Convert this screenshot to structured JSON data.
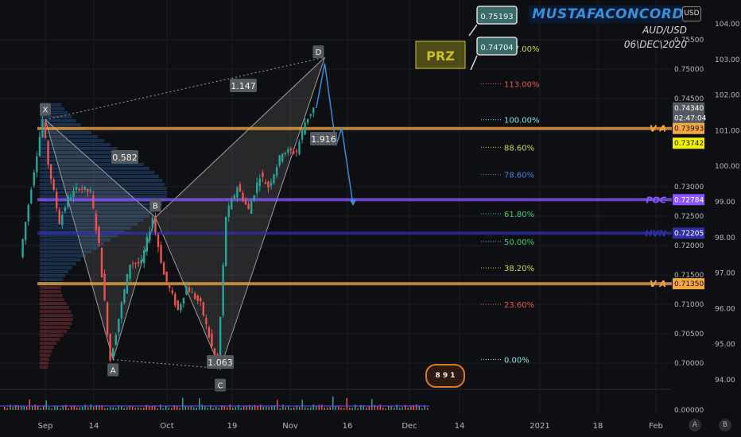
{
  "header": {
    "brand": "MUSTAFACONCORD",
    "symbol": "AUD/USD",
    "date": "06\\DEC\\2020",
    "currency_button": "USD"
  },
  "buttons": {
    "auto": "A",
    "b": "B"
  },
  "badge_text": "8 9 1",
  "colors": {
    "up": "#26a69a",
    "down": "#ef5350",
    "orange": "#f5a742",
    "purple": "#8a55ff",
    "navy": "#3030a8",
    "pattern_fill": "#9a9a9a",
    "projection": "#3d8bd8"
  },
  "chart_data": {
    "type": "candlestick",
    "symbol": "AUD/USD",
    "date_label": "06\\DEC\\2020",
    "x_ticks": [
      "Sep",
      "14",
      "Oct",
      "19",
      "Nov",
      "16",
      "Dec",
      "14",
      "2021",
      "18",
      "Feb"
    ],
    "price_axis": {
      "ticks": [
        "0.75500",
        "0.75000",
        "0.74500",
        "0.73000",
        "0.72500",
        "0.72000",
        "0.71500",
        "0.71000",
        "0.70500",
        "0.70000"
      ],
      "markers": [
        {
          "label": "0.74340",
          "price": 0.7434,
          "style": "grey"
        },
        {
          "label": "02:47:04",
          "price": 0.7417,
          "style": "grey"
        },
        {
          "label": "0.73993",
          "price": 0.7399,
          "style": "orange"
        },
        {
          "label": "0.73742",
          "price": 0.7374,
          "style": "yellow"
        },
        {
          "label": "0.72784",
          "price": 0.7278,
          "style": "purple"
        },
        {
          "label": "0.72205",
          "price": 0.7221,
          "style": "navy"
        },
        {
          "label": "0.71350",
          "price": 0.7135,
          "style": "orange"
        },
        {
          "label": "0.00000",
          "price": null,
          "style": "volume"
        }
      ],
      "volume_tick": "0.00000"
    },
    "index_axis": {
      "ticks": [
        "104.00",
        "103.00",
        "102.00",
        "101.00",
        "100.00",
        "99.00",
        "98.00",
        "97.00",
        "96.00",
        "95.00",
        "94.00"
      ]
    },
    "xabcd": {
      "points": [
        {
          "label": "X",
          "date": "2020-09-01",
          "price": 0.7414
        },
        {
          "label": "A",
          "date": "2020-09-25",
          "price": 0.7006
        },
        {
          "label": "B",
          "date": "2020-10-10",
          "price": 0.7248
        },
        {
          "label": "C",
          "date": "2020-11-02",
          "price": 0.6991
        },
        {
          "label": "D",
          "date": "2020-12-09",
          "price": 0.752
        }
      ],
      "ratios": [
        "0.582",
        "1.147",
        "1.916",
        "1.063"
      ],
      "prz_label": "PRZ",
      "callouts": [
        "0.75193",
        "0.74704"
      ]
    },
    "fib_levels": [
      {
        "label": "127.00%",
        "price": 0.7535,
        "color": "#c9d94a"
      },
      {
        "label": "113.00%",
        "price": 0.7475,
        "color": "#ef5350"
      },
      {
        "label": "100.00%",
        "price": 0.7414,
        "color": "#7fe3e3"
      },
      {
        "label": "88.60%",
        "price": 0.7367,
        "color": "#c9d94a"
      },
      {
        "label": "78.60%",
        "price": 0.7321,
        "color": "#3d8bd8"
      },
      {
        "label": "61.80%",
        "price": 0.7254,
        "color": "#3ecf6e"
      },
      {
        "label": "50.00%",
        "price": 0.7207,
        "color": "#3ecf6e"
      },
      {
        "label": "38.20%",
        "price": 0.7162,
        "color": "#c9d94a"
      },
      {
        "label": "23.60%",
        "price": 0.71,
        "color": "#ef5350"
      },
      {
        "label": "0.00%",
        "price": 0.7006,
        "color": "#7fe3e3"
      }
    ],
    "horizontal_levels": [
      {
        "label": "V A",
        "price": 0.7399,
        "color": "#f5a742"
      },
      {
        "label": "POC",
        "price": 0.7278,
        "color": "#8a55ff"
      },
      {
        "label": "HVN",
        "price": 0.7221,
        "color": "#3030a8"
      },
      {
        "label": "V A",
        "price": 0.7135,
        "color": "#f5a742"
      }
    ],
    "price_path": [
      {
        "date": "2020-08-24",
        "price": 0.718
      },
      {
        "date": "2020-08-28",
        "price": 0.73
      },
      {
        "date": "2020-09-01",
        "price": 0.7414
      },
      {
        "date": "2020-09-03",
        "price": 0.734
      },
      {
        "date": "2020-09-07",
        "price": 0.724
      },
      {
        "date": "2020-09-10",
        "price": 0.728
      },
      {
        "date": "2020-09-14",
        "price": 0.73
      },
      {
        "date": "2020-09-18",
        "price": 0.729
      },
      {
        "date": "2020-09-21",
        "price": 0.72
      },
      {
        "date": "2020-09-25",
        "price": 0.7006
      },
      {
        "date": "2020-09-29",
        "price": 0.71
      },
      {
        "date": "2020-10-02",
        "price": 0.717
      },
      {
        "date": "2020-10-06",
        "price": 0.717
      },
      {
        "date": "2020-10-10",
        "price": 0.7248
      },
      {
        "date": "2020-10-14",
        "price": 0.715
      },
      {
        "date": "2020-10-19",
        "price": 0.709
      },
      {
        "date": "2020-10-22",
        "price": 0.713
      },
      {
        "date": "2020-10-27",
        "price": 0.71
      },
      {
        "date": "2020-11-02",
        "price": 0.6991
      },
      {
        "date": "2020-11-05",
        "price": 0.725
      },
      {
        "date": "2020-11-09",
        "price": 0.73
      },
      {
        "date": "2020-11-13",
        "price": 0.726
      },
      {
        "date": "2020-11-17",
        "price": 0.732
      },
      {
        "date": "2020-11-20",
        "price": 0.73
      },
      {
        "date": "2020-11-25",
        "price": 0.736
      },
      {
        "date": "2020-11-30",
        "price": 0.736
      },
      {
        "date": "2020-12-03",
        "price": 0.741
      },
      {
        "date": "2020-12-06",
        "price": 0.7434
      }
    ],
    "projection": [
      {
        "date": "2020-12-06",
        "price": 0.7434
      },
      {
        "date": "2020-12-09",
        "price": 0.751
      },
      {
        "date": "2020-12-13",
        "price": 0.737
      },
      {
        "date": "2020-12-15",
        "price": 0.74
      },
      {
        "date": "2020-12-19",
        "price": 0.727
      }
    ],
    "volume_profile": true,
    "grid": true
  }
}
